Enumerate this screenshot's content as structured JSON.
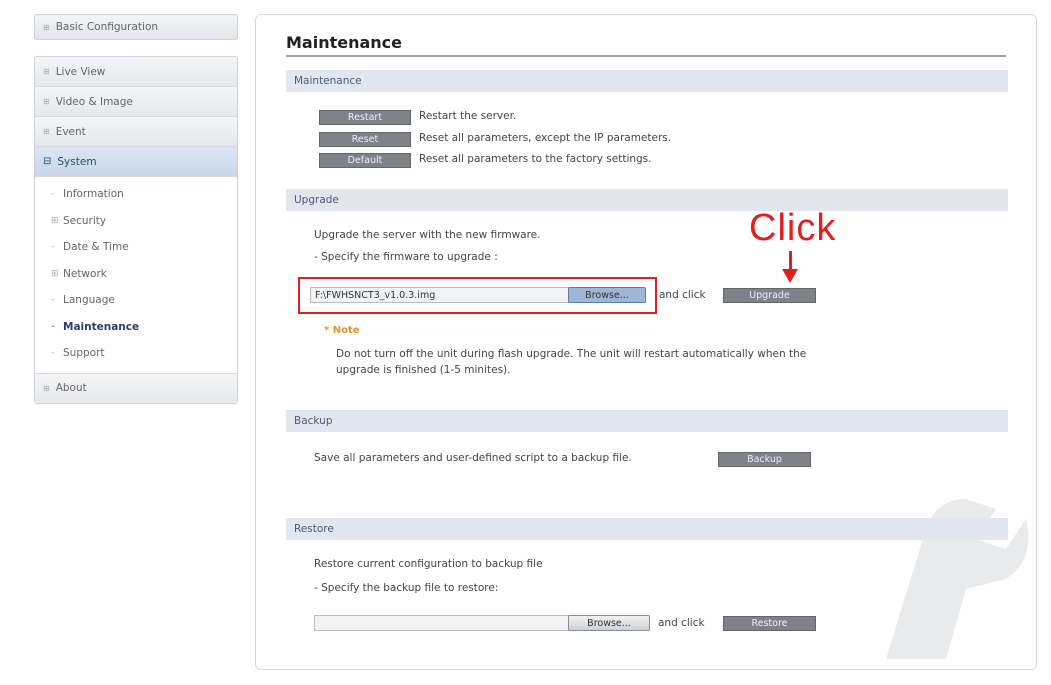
{
  "sidebar": {
    "basic_config": "Basic Configuration",
    "items": [
      {
        "label": "Live View"
      },
      {
        "label": "Video & Image"
      },
      {
        "label": "Event"
      },
      {
        "label": "System"
      }
    ],
    "system_subitems": [
      {
        "label": "Information",
        "prefix": "-"
      },
      {
        "label": "Security",
        "prefix": "⊞"
      },
      {
        "label": "Date & Time",
        "prefix": "-"
      },
      {
        "label": "Network",
        "prefix": "⊞"
      },
      {
        "label": "Language",
        "prefix": "-"
      },
      {
        "label": "Maintenance",
        "prefix": "-"
      },
      {
        "label": "Support",
        "prefix": "-"
      }
    ],
    "about": "About"
  },
  "main": {
    "title": "Maintenance",
    "maintenance": {
      "header": "Maintenance",
      "actions": [
        {
          "button": "Restart",
          "desc": "Restart the server."
        },
        {
          "button": "Reset",
          "desc": "Reset all parameters, except the IP parameters."
        },
        {
          "button": "Default",
          "desc": "Reset all parameters to the factory settings."
        }
      ]
    },
    "upgrade": {
      "header": "Upgrade",
      "line1": "Upgrade the server with the new firmware.",
      "line2": "- Specify the firmware to upgrade :",
      "file_value": "F:\\FWHSNCT3_v1.0.3.img",
      "browse_label": "Browse...",
      "and_click": "and click",
      "upgrade_button": "Upgrade",
      "note_title": "* Note",
      "note_line1": "Do not turn off the unit during flash upgrade. The unit will restart automatically when the",
      "note_line2": "upgrade is finished (1-5 minites).",
      "annotation": "Click"
    },
    "backup": {
      "header": "Backup",
      "text": "Save all parameters and user-defined script to a backup file.",
      "button": "Backup"
    },
    "restore": {
      "header": "Restore",
      "line1": "Restore current configuration to backup file",
      "line2": "- Specify the backup file to restore:",
      "file_value": "",
      "browse_label": "Browse...",
      "and_click": "and click",
      "button": "Restore"
    }
  },
  "colors": {
    "annotation_red": "#e02020",
    "section_header_bg": "#e2e6ee",
    "button_gray": "#7f8287",
    "note_orange": "#d8962c"
  }
}
